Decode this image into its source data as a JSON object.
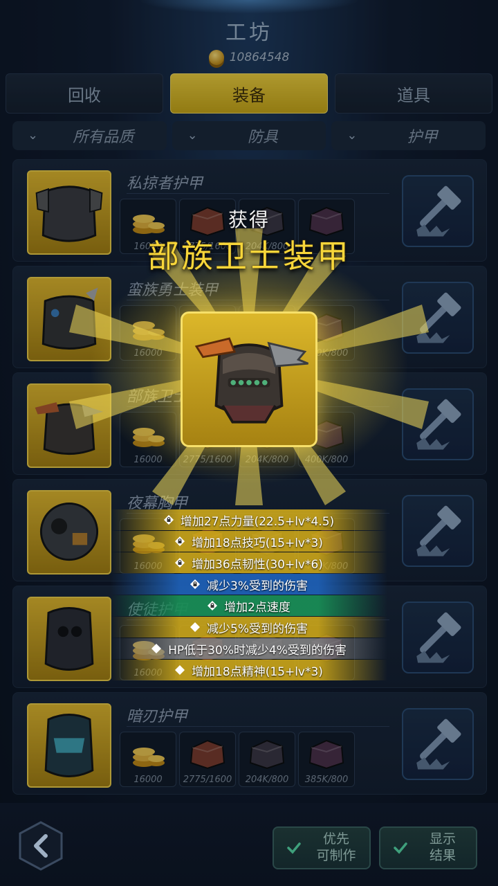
{
  "header": {
    "title": "工坊",
    "coins": "10864548"
  },
  "tabs": [
    {
      "label": "回收",
      "active": false
    },
    {
      "label": "装备",
      "active": true
    },
    {
      "label": "道具",
      "active": false
    }
  ],
  "filters": [
    {
      "label": "所有品质"
    },
    {
      "label": "防具"
    },
    {
      "label": "护甲"
    }
  ],
  "items": [
    {
      "name": "私掠者护甲",
      "materials": [
        "16000",
        "2775/1600",
        "204K/800",
        ""
      ]
    },
    {
      "name": "蛮族勇士装甲",
      "materials": [
        "16000",
        "",
        "",
        "400K/800"
      ]
    },
    {
      "name": "部族卫士装甲",
      "materials": [
        "16000",
        "2775/1600",
        "204K/800",
        "400K/800"
      ]
    },
    {
      "name": "夜幕胸甲",
      "materials": [
        "16000",
        "",
        "",
        "400K/800"
      ]
    },
    {
      "name": "使徒护甲",
      "materials": [
        "16000",
        "",
        "",
        ""
      ]
    },
    {
      "name": "暗刃护甲",
      "materials": [
        "16000",
        "2775/1600",
        "204K/800",
        "385K/800"
      ]
    }
  ],
  "popup": {
    "gain_label": "获得",
    "item_name": "部族卫士装甲",
    "stats": [
      {
        "text": "增加27点力量(22.5+lv*4.5)",
        "tier": "yellow",
        "bullet": "lock"
      },
      {
        "text": "增加18点技巧(15+lv*3)",
        "tier": "yellow",
        "bullet": "lock"
      },
      {
        "text": "增加36点韧性(30+lv*6)",
        "tier": "yellow",
        "bullet": "lock"
      },
      {
        "text": "减少3%受到的伤害",
        "tier": "blue",
        "bullet": "lock"
      },
      {
        "text": "增加2点速度",
        "tier": "green",
        "bullet": "lock"
      },
      {
        "text": "减少5%受到的伤害",
        "tier": "yellow",
        "bullet": "diamond"
      },
      {
        "text": "HP低于30%时减少4%受到的伤害",
        "tier": "gray",
        "bullet": "diamond"
      },
      {
        "text": "增加18点精神(15+lv*3)",
        "tier": "yellow",
        "bullet": "diamond"
      }
    ]
  },
  "bottom": {
    "priority_label_1": "优先",
    "priority_label_2": "可制作",
    "show_label_1": "显示",
    "show_label_2": "结果"
  },
  "colors": {
    "accent": "#f0cf3a",
    "gold_text": "#f7d63a"
  }
}
